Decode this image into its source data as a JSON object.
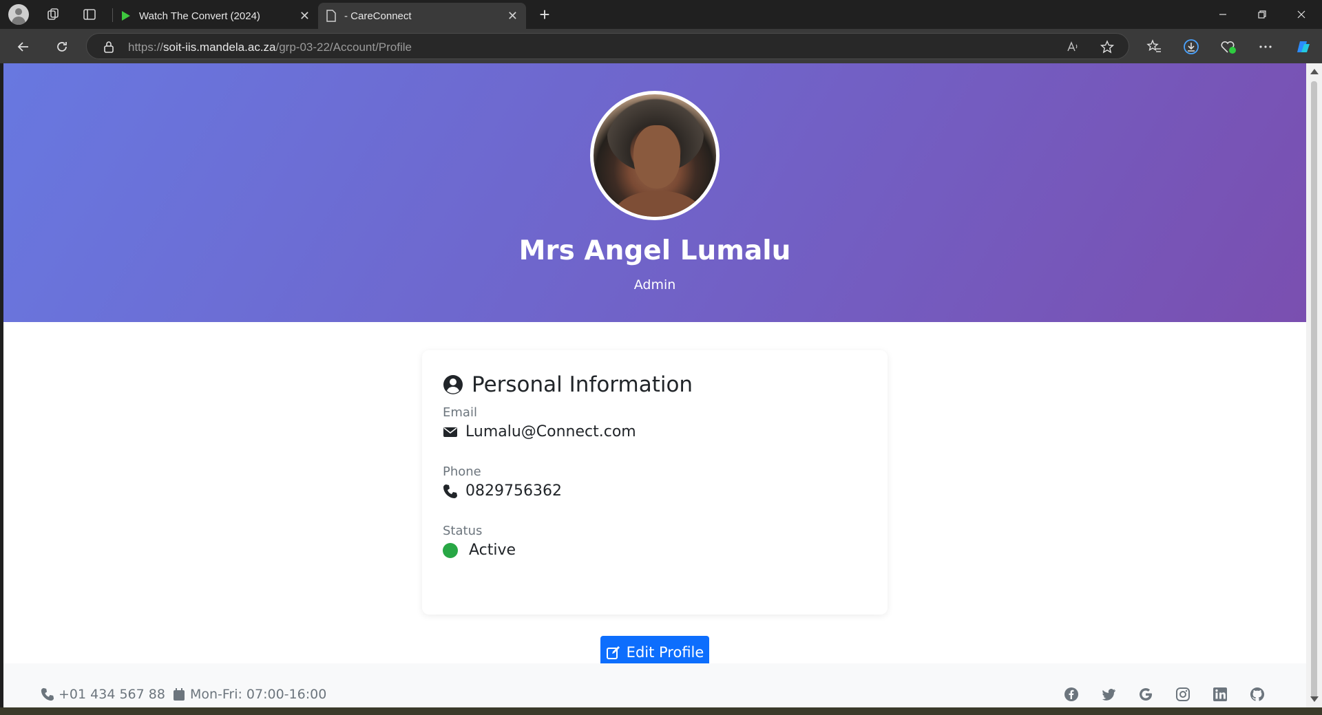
{
  "browser": {
    "tabs": [
      {
        "title": "Watch The Convert (2024)",
        "active": false
      },
      {
        "title": "- CareConnect",
        "active": true
      }
    ],
    "url_prefix": "https://",
    "url_host": "soit-iis.mandela.ac.za",
    "url_path": "/grp-03-22/Account/Profile",
    "close_glyph": "✕",
    "new_tab_glyph": "+"
  },
  "profile": {
    "name": "Mrs Angel Lumalu",
    "role": "Admin"
  },
  "personal_info": {
    "heading": "Personal Information",
    "email_label": "Email",
    "email_value": "Lumalu@Connect.com",
    "phone_label": "Phone",
    "phone_value": "0829756362",
    "status_label": "Status",
    "status_value": "Active"
  },
  "actions": {
    "edit_label": "Edit Profile"
  },
  "footer": {
    "phone": "+01 434 567 88",
    "hours": "Mon-Fri: 07:00-16:00",
    "social_icons": [
      "facebook-icon",
      "twitter-icon",
      "google-icon",
      "instagram-icon",
      "linkedin-icon",
      "github-icon"
    ]
  },
  "colors": {
    "hero_start": "#6878e0",
    "hero_end": "#7a4fb0",
    "primary_button": "#0d6efd",
    "status_active": "#28a745"
  }
}
